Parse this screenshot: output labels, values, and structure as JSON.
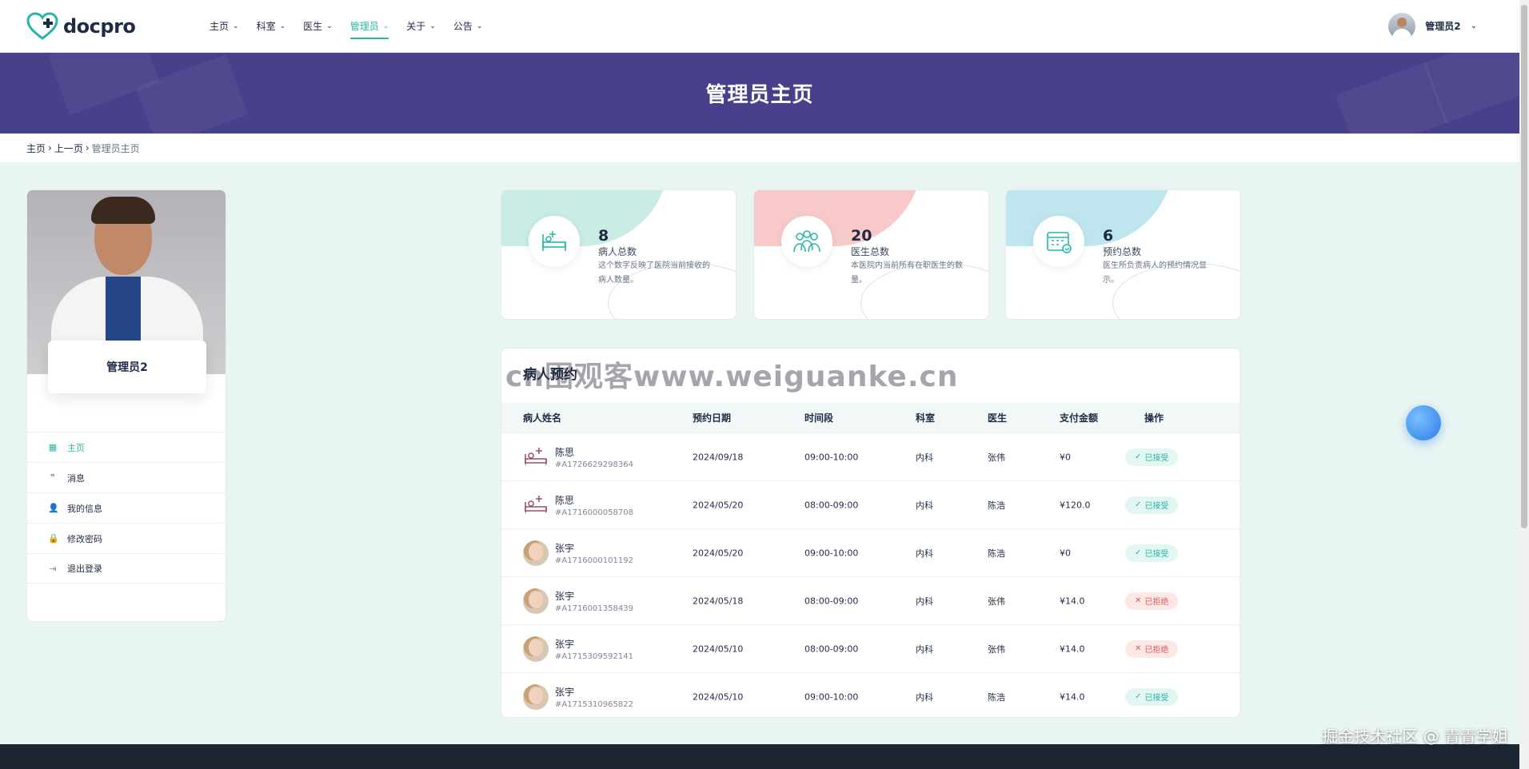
{
  "brand": {
    "name": "docpro"
  },
  "nav": {
    "items": [
      {
        "label": "主页"
      },
      {
        "label": "科室"
      },
      {
        "label": "医生"
      },
      {
        "label": "管理员",
        "active": true
      },
      {
        "label": "关于"
      },
      {
        "label": "公告"
      }
    ],
    "user_name": "管理员2"
  },
  "banner": {
    "title": "管理员主页"
  },
  "breadcrumb": {
    "home": "主页",
    "sep": "›",
    "prev": "上一页",
    "current": "管理员主页"
  },
  "profile": {
    "name": "管理员2",
    "menu": [
      {
        "label": "主页",
        "icon": "dashboard-icon",
        "glyph": "▦",
        "active": true
      },
      {
        "label": "消息",
        "icon": "chat-icon",
        "glyph": "❞"
      },
      {
        "label": "我的信息",
        "icon": "user-icon",
        "glyph": "👤"
      },
      {
        "label": "修改密码",
        "icon": "lock-icon",
        "glyph": "🔒"
      },
      {
        "label": "退出登录",
        "icon": "logout-icon",
        "glyph": "⇥"
      }
    ]
  },
  "stats": [
    {
      "value": "8",
      "label": "病人总数",
      "desc": "这个数字反映了医院当前接收的病人数量。",
      "icon": "bed-icon",
      "color": "#c9ece4"
    },
    {
      "value": "20",
      "label": "医生总数",
      "desc": "本医院内当前所有在职医生的数量。",
      "icon": "doctors-icon",
      "color": "#f8c9c9"
    },
    {
      "value": "6",
      "label": "预约总数",
      "desc": "医生所负责病人的预约情况显示。",
      "icon": "calendar-icon",
      "color": "#bfe6ee"
    }
  ],
  "table": {
    "title": "病人预约",
    "headers": [
      "病人姓名",
      "预约日期",
      "时间段",
      "科室",
      "医生",
      "支付金额",
      "操作"
    ],
    "rows": [
      {
        "name": "陈思",
        "id": "#A1726629298364",
        "date": "2024/09/18",
        "time": "09:00-10:00",
        "dept": "内科",
        "doctor": "张伟",
        "amount": "¥0",
        "status": "已接受",
        "ok": true,
        "avatar": "bed"
      },
      {
        "name": "陈思",
        "id": "#A1716000058708",
        "date": "2024/05/20",
        "time": "08:00-09:00",
        "dept": "内科",
        "doctor": "陈浩",
        "amount": "¥120.0",
        "status": "已接受",
        "ok": true,
        "avatar": "bed"
      },
      {
        "name": "张宇",
        "id": "#A1716000101192",
        "date": "2024/05/20",
        "time": "09:00-10:00",
        "dept": "内科",
        "doctor": "陈浩",
        "amount": "¥0",
        "status": "已接受",
        "ok": true,
        "avatar": "face"
      },
      {
        "name": "张宇",
        "id": "#A1716001358439",
        "date": "2024/05/18",
        "time": "08:00-09:00",
        "dept": "内科",
        "doctor": "张伟",
        "amount": "¥14.0",
        "status": "已拒绝",
        "ok": false,
        "avatar": "face"
      },
      {
        "name": "张宇",
        "id": "#A1715309592141",
        "date": "2024/05/10",
        "time": "08:00-09:00",
        "dept": "内科",
        "doctor": "张伟",
        "amount": "¥14.0",
        "status": "已拒绝",
        "ok": false,
        "avatar": "face"
      },
      {
        "name": "张宇",
        "id": "#A1715310965822",
        "date": "2024/05/10",
        "time": "09:00-10:00",
        "dept": "内科",
        "doctor": "陈浩",
        "amount": "¥14.0",
        "status": "已接受",
        "ok": true,
        "avatar": "face"
      }
    ]
  },
  "watermark": "cn围观客www.weiguanke.cn",
  "credit": "掘金技术社区 @ 青青学姐",
  "colors": {
    "accent": "#25b7a7",
    "banner": "#47408a",
    "reject": "#e25757"
  }
}
